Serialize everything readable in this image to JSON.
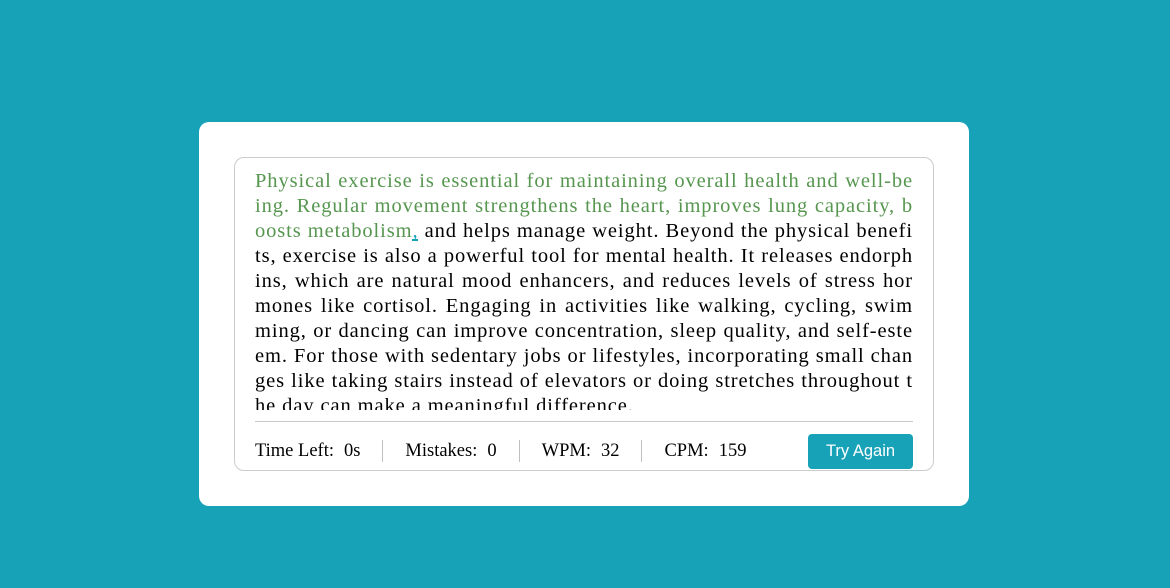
{
  "typing": {
    "typed_correct": "Physical exercise is essential for maintaining overall health and well-being. Regular movement strengthens the heart, improves lung capacity, boosts metabolism",
    "active_char": ",",
    "remaining": " and helps manage weight. Beyond the physical benefits, exercise is also a powerful tool for mental health. It releases endorphins, which are natural mood enhancers, and reduces levels of stress hormones like cortisol. Engaging in activities like walking, cycling, swimming, or dancing can improve concentration, sleep quality, and self-esteem. For those with sedentary jobs or lifestyles, incorporating small changes like taking stairs instead of elevators or doing stretches throughout the day can make a meaningful difference."
  },
  "stats": {
    "time_left_label": "Time Left:",
    "time_left_value": "0",
    "time_left_unit": "s",
    "mistakes_label": "Mistakes:",
    "mistakes_value": "0",
    "wpm_label": "WPM:",
    "wpm_value": "32",
    "cpm_label": "CPM:",
    "cpm_value": "159"
  },
  "actions": {
    "try_again_label": "Try Again"
  },
  "colors": {
    "background": "#17a2b8",
    "correct_text": "#56964f",
    "active_char": "#17a2b8",
    "button": "#17a2b8"
  }
}
